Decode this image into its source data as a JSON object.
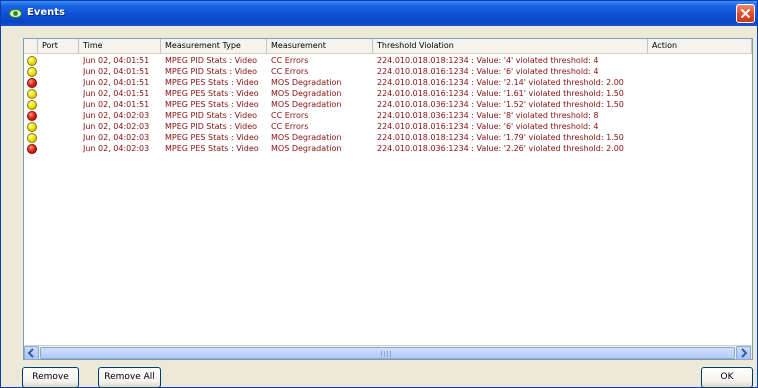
{
  "window": {
    "title": "Events"
  },
  "columns": [
    "",
    "Port",
    "Time",
    "Measurement Type",
    "Measurement",
    "Threshold Violation",
    "Action"
  ],
  "rows": [
    {
      "status": "yellow",
      "time": "Jun 02, 04:01:51",
      "type": "MPEG PID Stats : Video",
      "measurement": "CC Errors",
      "violation": "224.010.018.018:1234 : Value: '4' violated threshold: 4"
    },
    {
      "status": "yellow",
      "time": "Jun 02, 04:01:51",
      "type": "MPEG PID Stats : Video",
      "measurement": "CC Errors",
      "violation": "224.010.018.016:1234 : Value: '6' violated threshold: 4"
    },
    {
      "status": "red",
      "time": "Jun 02, 04:01:51",
      "type": "MPEG PES Stats : Video",
      "measurement": "MOS Degradation",
      "violation": "224.010.018.016:1234 : Value: '2.14' violated threshold: 2.00"
    },
    {
      "status": "yellow",
      "time": "Jun 02, 04:01:51",
      "type": "MPEG PES Stats : Video",
      "measurement": "MOS Degradation",
      "violation": "224.010.018.016:1234 : Value: '1.61' violated threshold: 1.50"
    },
    {
      "status": "yellow",
      "time": "Jun 02, 04:01:51",
      "type": "MPEG PES Stats : Video",
      "measurement": "MOS Degradation",
      "violation": "224.010.018.036:1234 : Value: '1.52' violated threshold: 1.50"
    },
    {
      "status": "red",
      "time": "Jun 02, 04:02:03",
      "type": "MPEG PID Stats : Video",
      "measurement": "CC Errors",
      "violation": "224.010.018.036:1234 : Value: '8' violated threshold: 8"
    },
    {
      "status": "yellow",
      "time": "Jun 02, 04:02:03",
      "type": "MPEG PID Stats : Video",
      "measurement": "CC Errors",
      "violation": "224.010.018.016:1234 : Value: '6' violated threshold: 4"
    },
    {
      "status": "yellow",
      "time": "Jun 02, 04:02:03",
      "type": "MPEG PES Stats : Video",
      "measurement": "MOS Degradation",
      "violation": "224.010.018.018:1234 : Value: '1.79' violated threshold: 1.50"
    },
    {
      "status": "red",
      "time": "Jun 02, 04:02:03",
      "type": "MPEG PES Stats : Video",
      "measurement": "MOS Degradation",
      "violation": "224.010.018.036:1234 : Value: '2.26' violated threshold: 2.00"
    }
  ],
  "buttons": {
    "remove": "Remove",
    "remove_all": "Remove All",
    "ok": "OK"
  },
  "colors": {
    "title_bar": "#0c4ed2",
    "row_text": "#8a0f0f",
    "status_yellow": "#f2e21a",
    "status_red": "#e62a14"
  },
  "icons": {
    "window": "eye-icon",
    "close": "close-icon",
    "scroll_left": "arrow-left-icon",
    "scroll_right": "arrow-right-icon"
  }
}
